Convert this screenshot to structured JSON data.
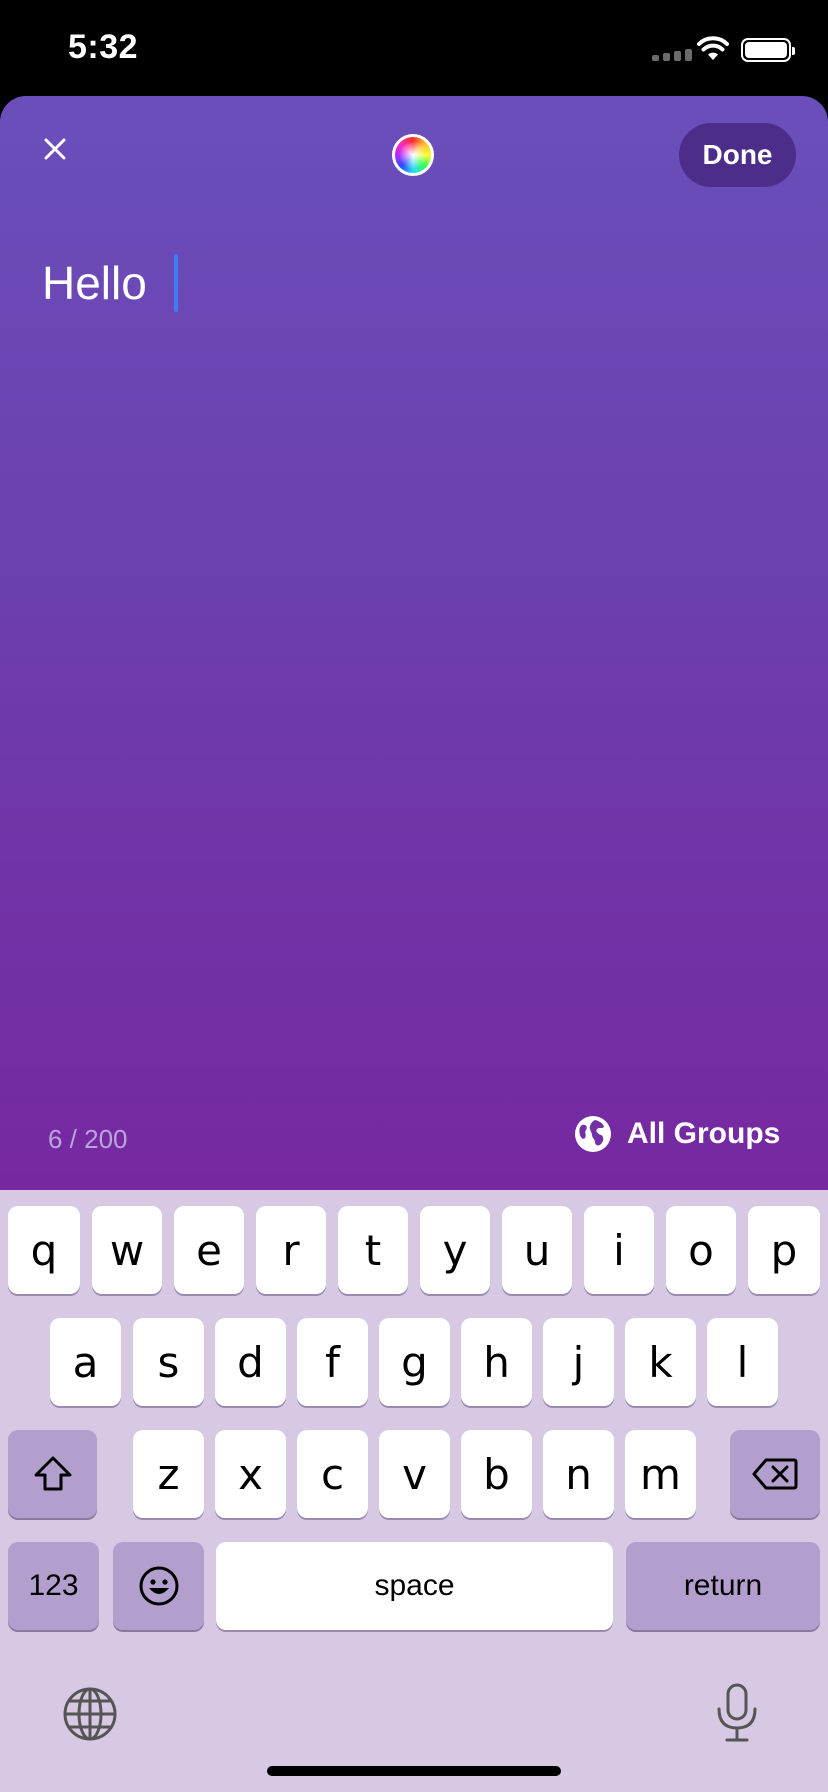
{
  "status_bar": {
    "time": "5:32"
  },
  "compose": {
    "close_icon": "close-icon",
    "color_picker_icon": "color-wheel-icon",
    "done_label": "Done",
    "text": "Hello ",
    "char_count": "6 / 200",
    "audience_icon": "globe-icon",
    "audience_label": "All Groups"
  },
  "keyboard": {
    "row1": [
      "q",
      "w",
      "e",
      "r",
      "t",
      "y",
      "u",
      "i",
      "o",
      "p"
    ],
    "row2": [
      "a",
      "s",
      "d",
      "f",
      "g",
      "h",
      "j",
      "k",
      "l"
    ],
    "row3": [
      "z",
      "x",
      "c",
      "v",
      "b",
      "n",
      "m"
    ],
    "numbers_label": "123",
    "space_label": "space",
    "return_label": "return",
    "shift_icon": "shift-icon",
    "delete_icon": "backspace-icon",
    "emoji_icon": "emoji-icon",
    "globe_icon": "globe-icon",
    "mic_icon": "microphone-icon"
  },
  "colors": {
    "sheet_top": "#6a4fba",
    "sheet_bottom": "#7628a0",
    "done_bg": "#4d2d8a",
    "cursor": "#3f7cf5",
    "keyboard_bg": "#d7c9e4"
  }
}
